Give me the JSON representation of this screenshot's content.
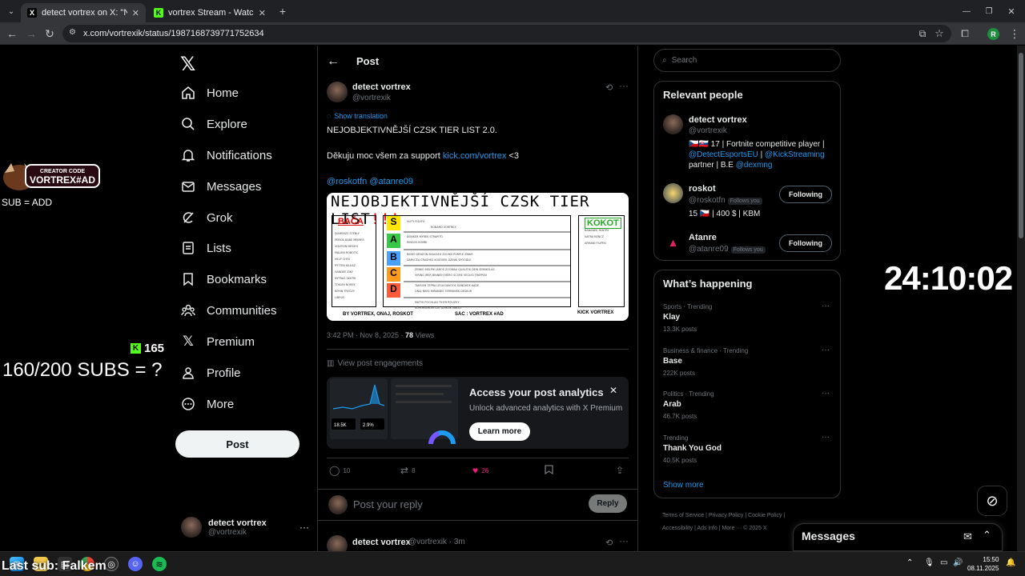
{
  "browser": {
    "tabs": [
      {
        "title": "detect vortrex on X: \"NEJOBJEK",
        "favicon": "X"
      },
      {
        "title": "vortrex Stream - Watch Live on",
        "favicon": "K"
      }
    ],
    "new_tab": "+",
    "url": "x.com/vortrexik/status/1987168739771752634",
    "profile_initial": "R"
  },
  "overlay": {
    "logo_top": "CREATOR CODE",
    "logo_main": "VORTREX#AD",
    "sub_add": "SUB = ADD",
    "kick_count": "165",
    "subs_goal": "160/200 SUBS = ?",
    "last_sub": "Last sub: Falkem",
    "timer": "24:10:02"
  },
  "nav": {
    "items": [
      {
        "label": "Home",
        "icon": "home-icon"
      },
      {
        "label": "Explore",
        "icon": "search-icon"
      },
      {
        "label": "Notifications",
        "icon": "bell-icon"
      },
      {
        "label": "Messages",
        "icon": "envelope-icon"
      },
      {
        "label": "Grok",
        "icon": "grok-icon"
      },
      {
        "label": "Lists",
        "icon": "list-icon"
      },
      {
        "label": "Bookmarks",
        "icon": "bookmark-icon"
      },
      {
        "label": "Communities",
        "icon": "people-icon"
      },
      {
        "label": "Premium",
        "icon": "x-icon"
      },
      {
        "label": "Profile",
        "icon": "person-icon"
      },
      {
        "label": "More",
        "icon": "more-circle-icon"
      }
    ],
    "post_button": "Post",
    "account": {
      "name": "detect vortrex",
      "handle": "@vortrexik"
    }
  },
  "post": {
    "header": "Post",
    "author": {
      "name": "detect vortrex",
      "handle": "@vortrexik"
    },
    "show_translation": "Show translation",
    "line1": "NEJOBJEKTIVNĚJŠÍ CZSK TIER LIST 2.0.",
    "line2_text": "Děkuju moc všem za support ",
    "line2_link": "kick.com/vortrex",
    "line2_end": " <3",
    "mentions": "@roskotfn @atanre09",
    "image": {
      "title": "NEJOBJEKTIVNĚJŠÍ CZSK TIER LIST",
      "title_marks": "!!!",
      "left_box": "BAČA",
      "right_box": "KOKOT",
      "tiers": [
        "S",
        "A",
        "B",
        "C",
        "D"
      ],
      "footer_left": "BY VORTREX, ONAJ, ROSKOT",
      "footer_mid": "SAC : VORTREX #AD",
      "footer_right": "KICK VORTREX"
    },
    "time": "3:42 PM · Nov 8, 2025 · ",
    "views_count": "78",
    "views_label": " Views",
    "view_engagements": "View post engagements",
    "analytics": {
      "title": "Access your post analytics",
      "subtitle": "Unlock advanced analytics with X Premium",
      "button": "Learn more",
      "thumb_a": "18.5K",
      "thumb_b": "2.9%"
    },
    "actions": {
      "replies": "10",
      "reposts": "8",
      "likes": "26"
    },
    "reply_placeholder": "Post your reply",
    "reply_button": "Reply",
    "next_reply": {
      "name": "detect vortrex",
      "handle": "@vortrexik · 3m"
    }
  },
  "right": {
    "search_placeholder": "Search",
    "relevant_title": "Relevant people",
    "people": [
      {
        "name": "detect vortrex",
        "handle": "@vortrexik",
        "bio_1": "🇨🇿🇸🇰 17 | Fortnite competitive player |",
        "bio_2a": "@DetectEsportsEU",
        "bio_2b": " | ",
        "bio_2c": "@KickStreaming",
        "bio_3a": "partner | B.E ",
        "bio_3b": "@dexmng"
      },
      {
        "name": "roskot",
        "handle": "@roskotfn",
        "follows_you": "Follows you",
        "bio": "15 🇨🇿 | 400 $ | KBM",
        "button": "Following"
      },
      {
        "name": "Atanre",
        "handle": "@atanre09",
        "follows_you": "Follows you",
        "button": "Following"
      }
    ],
    "happening_title": "What’s happening",
    "trends": [
      {
        "meta": "Sports · Trending",
        "name": "Klay",
        "count": "13.3K posts"
      },
      {
        "meta": "Business & finance · Trending",
        "name": "Base",
        "count": "222K posts"
      },
      {
        "meta": "Politics · Trending",
        "name": "Arab",
        "count": "46.7K posts"
      },
      {
        "meta": "Trending",
        "name": "Thank You God",
        "count": "40.5K posts"
      }
    ],
    "show_more": "Show more",
    "footer_1": "Terms of Service  |  Privacy Policy  |  Cookie Policy  |",
    "footer_2": "Accessibility  |  Ads info  |  More ···  © 2025 X",
    "messages": "Messages"
  },
  "taskbar": {
    "time": "15:50",
    "date": "08.11.2025"
  },
  "colors": {
    "accent": "#1d9bf0",
    "like": "#f91880",
    "kick": "#53fc18",
    "bg": "#000000"
  }
}
